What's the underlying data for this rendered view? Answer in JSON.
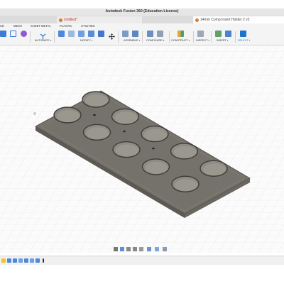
{
  "window": {
    "title": "Autodesk Fusion 360 (Education License)"
  },
  "doc_tabs": [
    {
      "label": "Untitled*"
    },
    {
      "label": "14mm Comp Insert Holder 2 v2"
    }
  ],
  "ribbon_tabs": [
    "CE",
    "MESH",
    "SHEET METAL",
    "PLASTIC",
    "UTILITIES"
  ],
  "toolbar_groups": {
    "automate": "AUTOMATE",
    "modify": "MODIFY",
    "assemble": "ASSEMBLE",
    "configure": "CONFIGURE",
    "construct": "CONSTRUCT",
    "inspect": "INSPECT",
    "insert": "INSERT",
    "select": "SELECT"
  },
  "model": {
    "holes": 10
  },
  "colors": {
    "accent": "#1b75d0",
    "model_top": "#75726b",
    "model_side": "#5f5c56",
    "hole_fill": "#8e8b84"
  }
}
